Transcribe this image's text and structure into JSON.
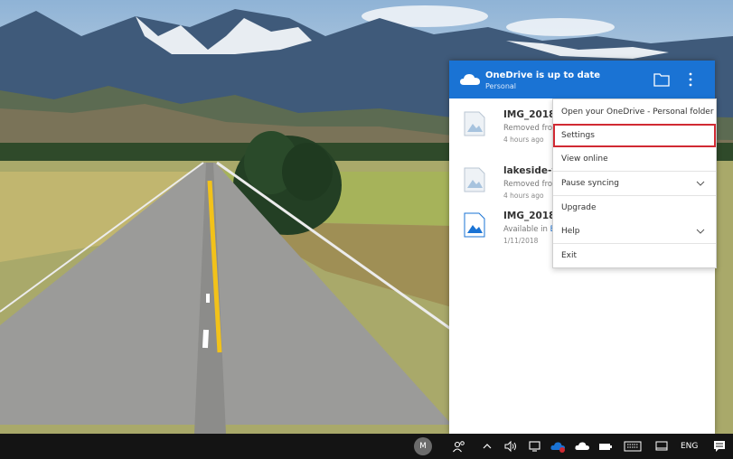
{
  "onedrive": {
    "status_title": "OneDrive is up to date",
    "account": "Personal",
    "header_icons": [
      "cloud-icon",
      "folder-icon",
      "more-options-icon"
    ],
    "accent_color": "#1a73d4"
  },
  "files": [
    {
      "name": "IMG_2018(",
      "status": "Removed fro",
      "time": "4 hours ago"
    },
    {
      "name": "lakeside-vi",
      "status": "Removed fro",
      "time": "4 hours ago"
    },
    {
      "name": "IMG_2018(",
      "status_prefix": "Available in ",
      "status_link": "E",
      "time": "1/11/2018"
    }
  ],
  "menu": {
    "items": [
      {
        "label": "Open your OneDrive - Personal folder"
      },
      {
        "label": "Settings",
        "highlighted": true
      },
      {
        "label": "View online"
      },
      {
        "label": "Pause syncing",
        "has_submenu": true
      },
      {
        "label": "Upgrade"
      },
      {
        "label": "Help",
        "has_submenu": true
      },
      {
        "label": "Exit"
      }
    ],
    "highlight_color": "#d12a33"
  },
  "taskbar": {
    "avatar_initial": "M",
    "language": "ENG",
    "icons": [
      "people-icon",
      "chevron-up-icon",
      "volume-icon",
      "network-icon",
      "onedrive-syncing-icon",
      "onedrive-icon",
      "battery-icon",
      "keyboard-icon",
      "tablet-icon",
      "notification-icon"
    ]
  }
}
